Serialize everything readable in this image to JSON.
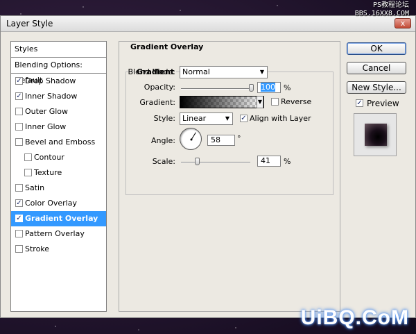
{
  "watermark": {
    "top_line1": "PS教程论坛",
    "top_line2": "BBS.16XX8.COM",
    "bottom": "UiBQ.CoM"
  },
  "window": {
    "title": "Layer Style",
    "close_label": "x"
  },
  "styles_list": {
    "header": "Styles",
    "blending": "Blending Options: Default",
    "items": [
      {
        "label": "Drop Shadow",
        "checked": true
      },
      {
        "label": "Inner Shadow",
        "checked": true
      },
      {
        "label": "Outer Glow",
        "checked": false
      },
      {
        "label": "Inner Glow",
        "checked": false
      },
      {
        "label": "Bevel and Emboss",
        "checked": false
      },
      {
        "label": "Contour",
        "checked": false,
        "sub": true
      },
      {
        "label": "Texture",
        "checked": false,
        "sub": true
      },
      {
        "label": "Satin",
        "checked": false
      },
      {
        "label": "Color Overlay",
        "checked": true
      },
      {
        "label": "Gradient Overlay",
        "checked": true,
        "selected": true
      },
      {
        "label": "Pattern Overlay",
        "checked": false
      },
      {
        "label": "Stroke",
        "checked": false
      }
    ]
  },
  "gradient_overlay": {
    "section_title": "Gradient Overlay",
    "group_title": "Gradient",
    "blend_mode_label": "Blend Mode:",
    "blend_mode_value": "Normal",
    "opacity_label": "Opacity:",
    "opacity_value": "100",
    "opacity_unit": "%",
    "opacity_fraction": 1.0,
    "gradient_label": "Gradient:",
    "reverse_label": "Reverse",
    "reverse_checked": false,
    "style_label": "Style:",
    "style_value": "Linear",
    "align_label": "Align with Layer",
    "align_checked": true,
    "angle_label": "Angle:",
    "angle_value": "58",
    "angle_unit": "°",
    "scale_label": "Scale:",
    "scale_value": "41",
    "scale_unit": "%",
    "scale_fraction": 0.41
  },
  "buttons": {
    "ok": "OK",
    "cancel": "Cancel",
    "new_style": "New Style...",
    "preview_label": "Preview",
    "preview_checked": true
  }
}
